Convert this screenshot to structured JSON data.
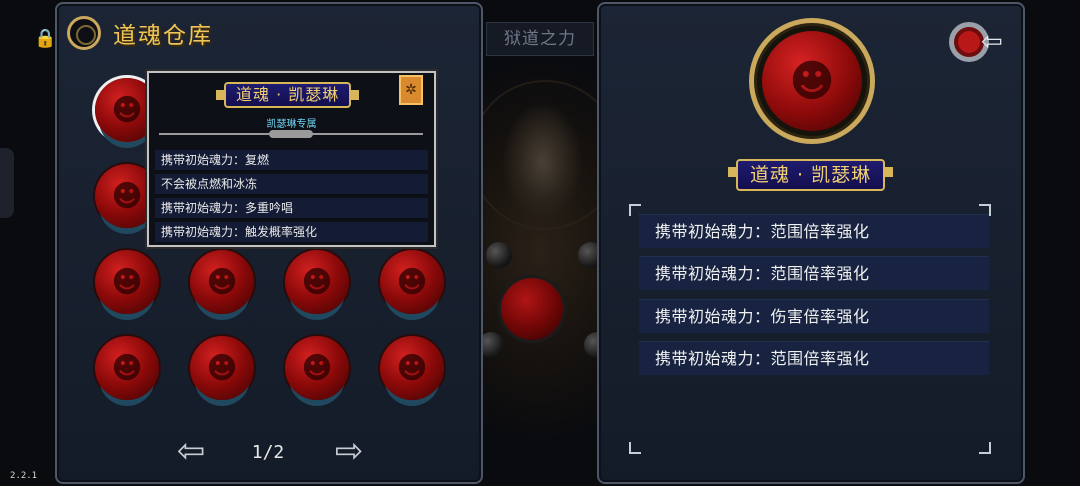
{
  "version": "2.2.1",
  "background_title": "狱道之力",
  "left_panel": {
    "title": "道魂仓库",
    "pager": "1/2",
    "orbs": [
      "orb-1",
      "orb-2",
      "orb-3",
      "orb-4",
      "orb-5",
      "orb-6",
      "orb-7",
      "orb-8",
      "orb-9",
      "orb-10",
      "orb-11",
      "orb-12"
    ]
  },
  "tooltip": {
    "name": "道魂 · 凯瑟琳",
    "exclusive": "凯瑟琳专属",
    "badge_icon": "gear-badge-icon",
    "lines": [
      "携带初始魂力：复燃",
      "不会被点燃和冰冻",
      "携带初始魂力：多重吟唱",
      "携带初始魂力：触发概率强化"
    ]
  },
  "right_panel": {
    "name": "道魂 · 凯瑟琳",
    "traits": [
      "携带初始魂力：范围倍率强化",
      "携带初始魂力：范围倍率强化",
      "携带初始魂力：伤害倍率强化",
      "携带初始魂力：范围倍率强化"
    ]
  },
  "colors": {
    "gold": "#caa85c",
    "title_gold": "#f2c654",
    "orb_red": "#b11515",
    "exclusive_cyan": "#6fd3f3",
    "panel_bg": "#1c2535"
  }
}
